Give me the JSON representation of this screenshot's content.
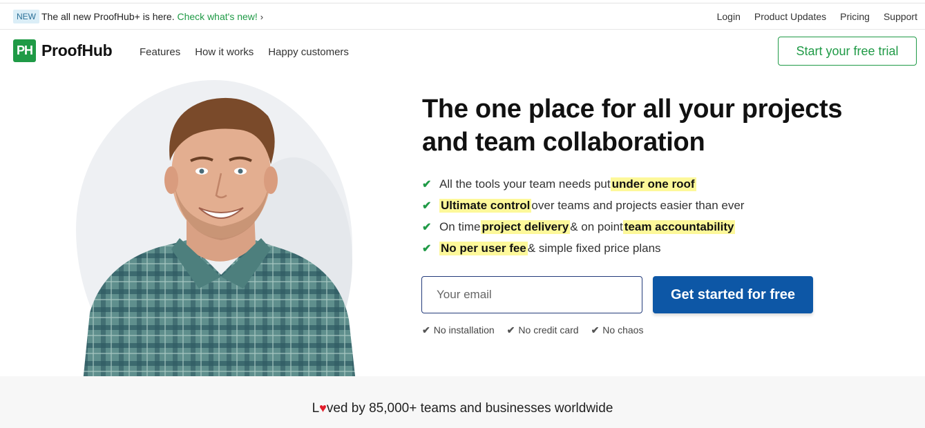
{
  "topbar": {
    "badge": "NEW",
    "announcement": "The all new ProofHub+ is here.",
    "link": "Check what's new!",
    "links": [
      "Login",
      "Product Updates",
      "Pricing",
      "Support"
    ]
  },
  "nav": {
    "logo_mark": "PH",
    "logo_text": "ProofHub",
    "links": [
      "Features",
      "How it works",
      "Happy customers"
    ],
    "trial_button": "Start your free trial"
  },
  "hero": {
    "headline_line1": "The one place for all your projects",
    "headline_line2": "and team collaboration",
    "features": [
      {
        "pre": "All the tools your team needs put ",
        "hl": "under one roof",
        "mid": "",
        "hl2": "",
        "post": ""
      },
      {
        "pre": "",
        "hl": "Ultimate control",
        "mid": " over teams and projects easier than ever",
        "hl2": "",
        "post": ""
      },
      {
        "pre": "On time ",
        "hl": "project delivery",
        "mid": " & on point ",
        "hl2": "team accountability",
        "post": ""
      },
      {
        "pre": "",
        "hl": "No per user fee",
        "mid": " & simple fixed price plans",
        "hl2": "",
        "post": ""
      }
    ],
    "email_placeholder": "Your email",
    "cta": "Get started for free",
    "perks": [
      "No installation",
      "No credit card",
      "No chaos"
    ]
  },
  "band": {
    "loved_l": "L",
    "loved_rest": "ved by 85,000+ teams and businesses worldwide"
  },
  "colors": {
    "brand_green": "#1f9a46",
    "cta_blue": "#0d57a6",
    "highlight": "#fdf89a",
    "heart": "#e11d2a"
  },
  "icons": [
    "check-icon",
    "chevron-right-icon",
    "heart-icon"
  ]
}
